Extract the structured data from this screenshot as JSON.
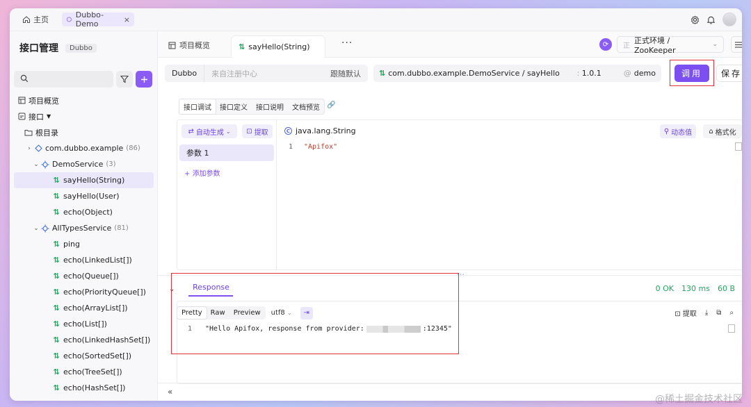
{
  "topbar": {
    "home_label": "主页",
    "project_tab": "Dubbo-Demo",
    "close": "×"
  },
  "sidebar": {
    "title": "接口管理",
    "badge": "Dubbo",
    "overview": "项目概览",
    "api_label": "接口",
    "root": "根目录",
    "package": {
      "name": "com.dubbo.example",
      "count": "(86)"
    },
    "demo_service": {
      "name": "DemoService",
      "count": "(3)"
    },
    "demo_methods": [
      "sayHello(String)",
      "sayHello(User)",
      "echo(Object)"
    ],
    "alltypes_service": {
      "name": "AllTypesService",
      "count": "(81)"
    },
    "alltypes_methods": [
      "ping",
      "echo(LinkedList[])",
      "echo(Queue[])",
      "echo(PriorityQueue[])",
      "echo(ArrayList[])",
      "echo(List[])",
      "echo(LinkedHashSet[])",
      "echo(SortedSet[])",
      "echo(TreeSet[])",
      "echo(HashSet[])"
    ]
  },
  "main": {
    "tab_overview": "项目概览",
    "tab_active": "sayHello(String)",
    "env": "正式环境 / ZooKeeper",
    "env_icon": "正",
    "protocol": "Dubbo",
    "registry_placeholder": "来自注册中心",
    "follow_default": "跟随默认",
    "service_path": "com.dubbo.example.DemoService / sayHello",
    "version": "1.0.1",
    "group": "demo",
    "invoke": "调用",
    "save": "保存",
    "subtabs": [
      "接口调试",
      "接口定义",
      "接口说明",
      "文档预览"
    ],
    "autogen": "自动生成",
    "extract": "提取",
    "param": "参数 1",
    "add_param": "添加参数",
    "param_type": "java.lang.String",
    "dynamic_value": "动态值",
    "format": "格式化",
    "code_line": "1",
    "code_value": "\"Apifox\""
  },
  "response": {
    "tab": "Response",
    "status": "0 OK",
    "time": "130 ms",
    "size": "60 B",
    "views": [
      "Pretty",
      "Raw",
      "Preview"
    ],
    "encoding": "utf8",
    "extract": "提取",
    "line": "1",
    "body_start": "\"Hello Apifox, response from provider:",
    "body_end": ":12345\""
  },
  "watermark": "@稀土掘金技术社区",
  "colors": {
    "accent": "#7b4ff0",
    "success": "#22a55f",
    "highlight": "#e0303a"
  }
}
